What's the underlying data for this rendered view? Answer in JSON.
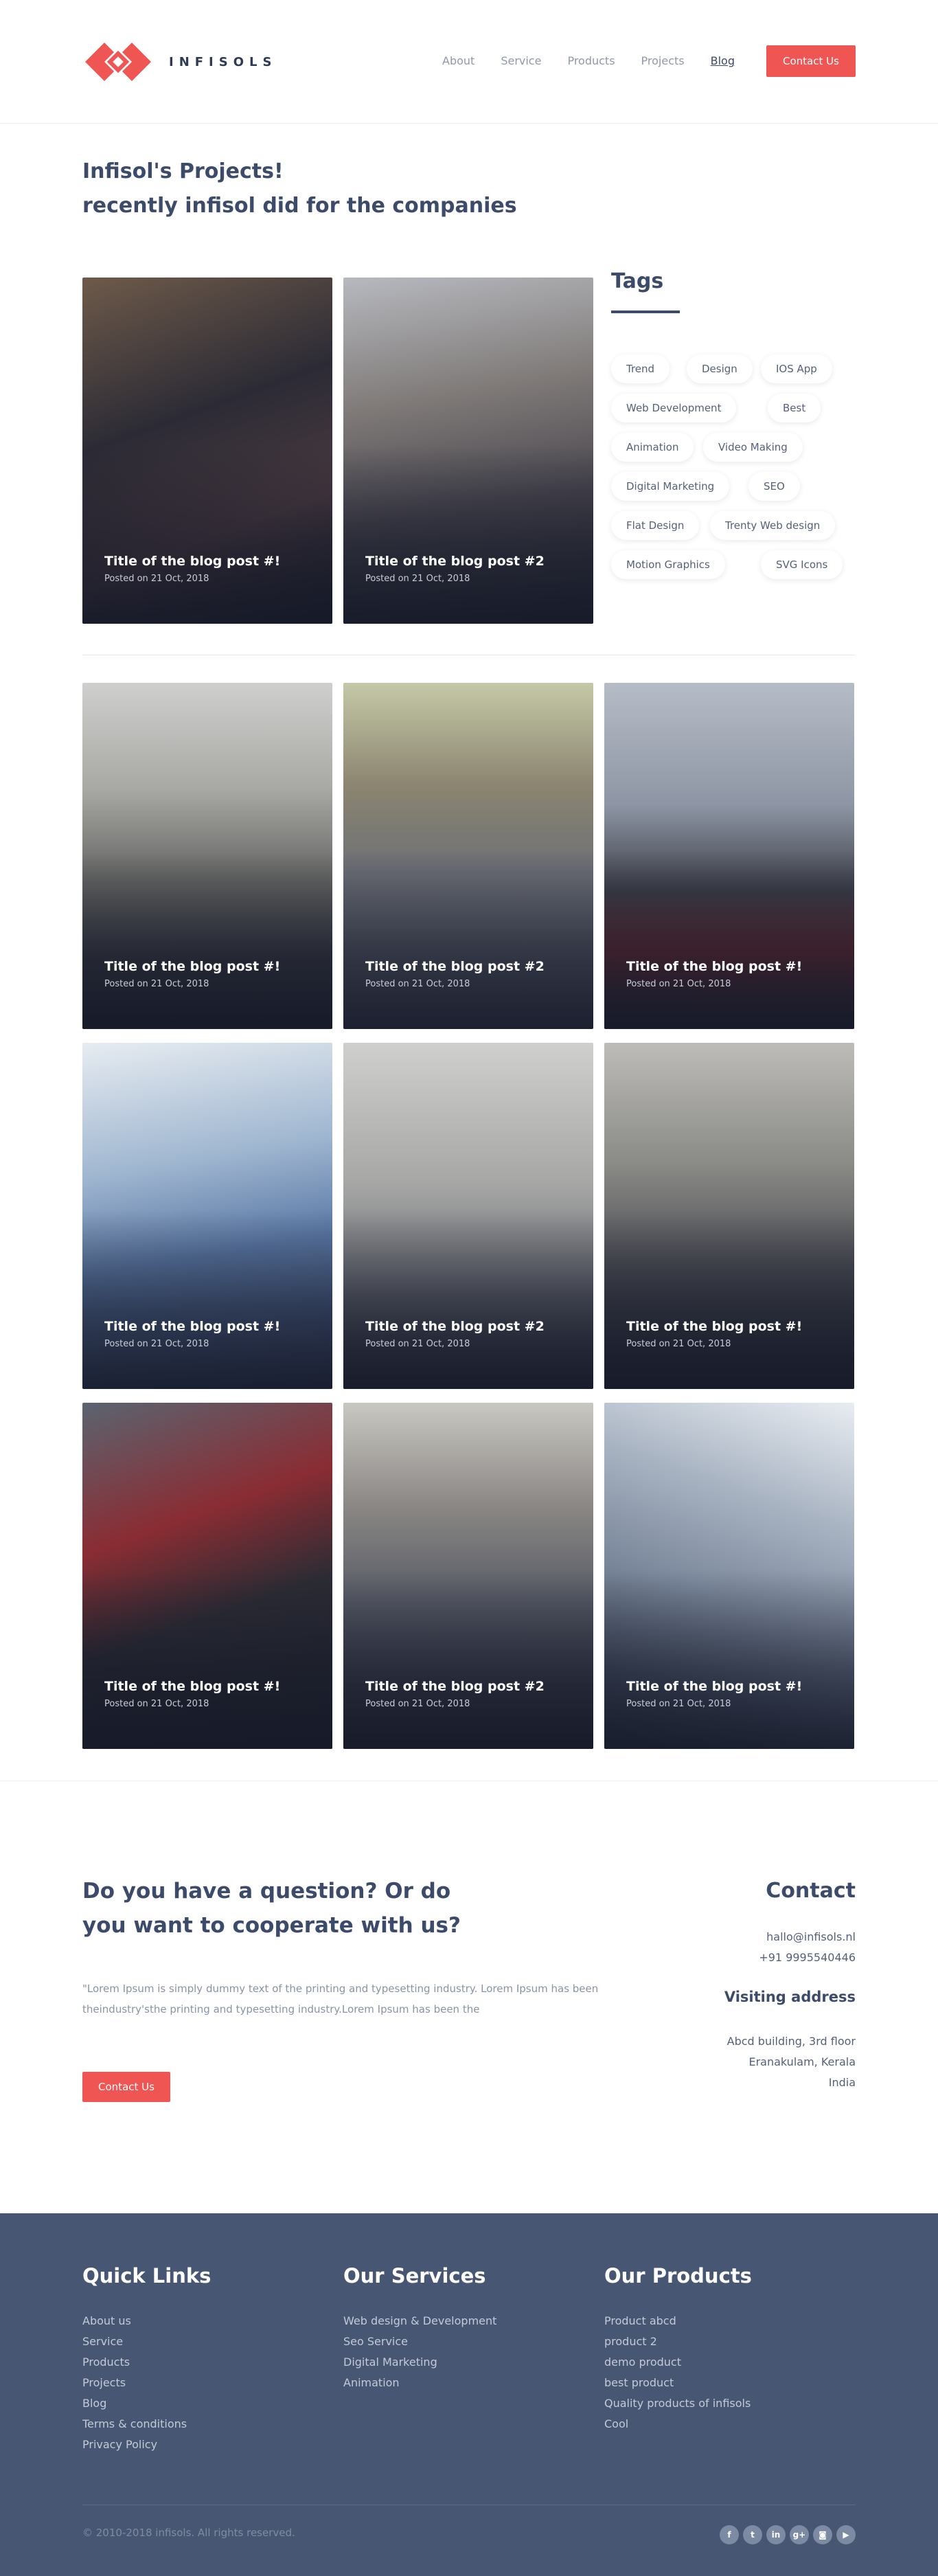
{
  "header": {
    "brand": "INFISOLS",
    "nav": [
      "About",
      "Service",
      "Products",
      "Projects",
      "Blog"
    ],
    "active_nav": "Blog",
    "cta": "Contact Us",
    "brand_color": "#ef5553"
  },
  "intro": {
    "line1": "Infisol's Projects!",
    "line2": "recently infisol did for the companies"
  },
  "featured_posts": [
    {
      "title": "Title of the blog post #!",
      "date": "Posted on  21 Oct, 2018"
    },
    {
      "title": "Title of the blog post #2",
      "date": "Posted on  21 Oct, 2018"
    }
  ],
  "tags": {
    "heading": "Tags",
    "items": [
      "Trend",
      "Design",
      "IOS App",
      "Web Development",
      "Best",
      "Animation",
      "Video Making",
      "Digital Marketing",
      "SEO",
      "Flat Design",
      "Trenty Web design",
      "Motion Graphics",
      "SVG Icons"
    ]
  },
  "grid_posts": [
    {
      "title": "Title of the blog post #!",
      "date": "Posted on  21 Oct, 2018"
    },
    {
      "title": "Title of the blog post #2",
      "date": "Posted on  21 Oct, 2018"
    },
    {
      "title": "Title of the blog post #!",
      "date": "Posted on  21 Oct, 2018"
    },
    {
      "title": "Title of the blog post #!",
      "date": "Posted on  21 Oct, 2018"
    },
    {
      "title": "Title of the blog post #2",
      "date": "Posted on  21 Oct, 2018"
    },
    {
      "title": "Title of the blog post #!",
      "date": "Posted on  21 Oct, 2018"
    },
    {
      "title": "Title of the blog post #!",
      "date": "Posted on  21 Oct, 2018"
    },
    {
      "title": "Title of the blog post #2",
      "date": "Posted on  21 Oct, 2018"
    },
    {
      "title": "Title of the blog post #!",
      "date": "Posted on  21 Oct, 2018"
    }
  ],
  "question": {
    "line1": "Do you have a question? Or do",
    "line2": "you want to cooperate with us?",
    "text": "\"Lorem Ipsum is simply dummy text of the printing and typesetting industry. Lorem Ipsum has been theindustry'sthe printing and typesetting industry.Lorem Ipsum has been the",
    "button": "Contact Us"
  },
  "contact": {
    "heading": "Contact",
    "email": "hallo@infisols.nl",
    "phone": "+91  9995540446",
    "visit_heading": "Visiting address",
    "address": [
      "Abcd building, 3rd floor",
      "Eranakulam, Kerala",
      "India"
    ]
  },
  "footer": {
    "quick_links": {
      "heading": "Quick Links",
      "items": [
        "About us",
        "Service",
        "Products",
        "Projects",
        "Blog",
        "Terms & conditions",
        "Privacy Policy"
      ]
    },
    "services": {
      "heading": "Our Services",
      "items": [
        "Web design & Development",
        "Seo Service",
        "Digital Marketing",
        "Animation"
      ]
    },
    "products": {
      "heading": "Our Products",
      "items": [
        "Product abcd",
        "product 2",
        "demo product",
        "best product",
        "Quality products of infisols",
        "Cool"
      ]
    },
    "copyright": "©  2010-2018 infisols. All rights reserved.",
    "social": [
      "facebook-icon",
      "twitter-icon",
      "linkedin-icon",
      "google-plus-icon",
      "instagram-icon",
      "youtube-icon"
    ]
  }
}
